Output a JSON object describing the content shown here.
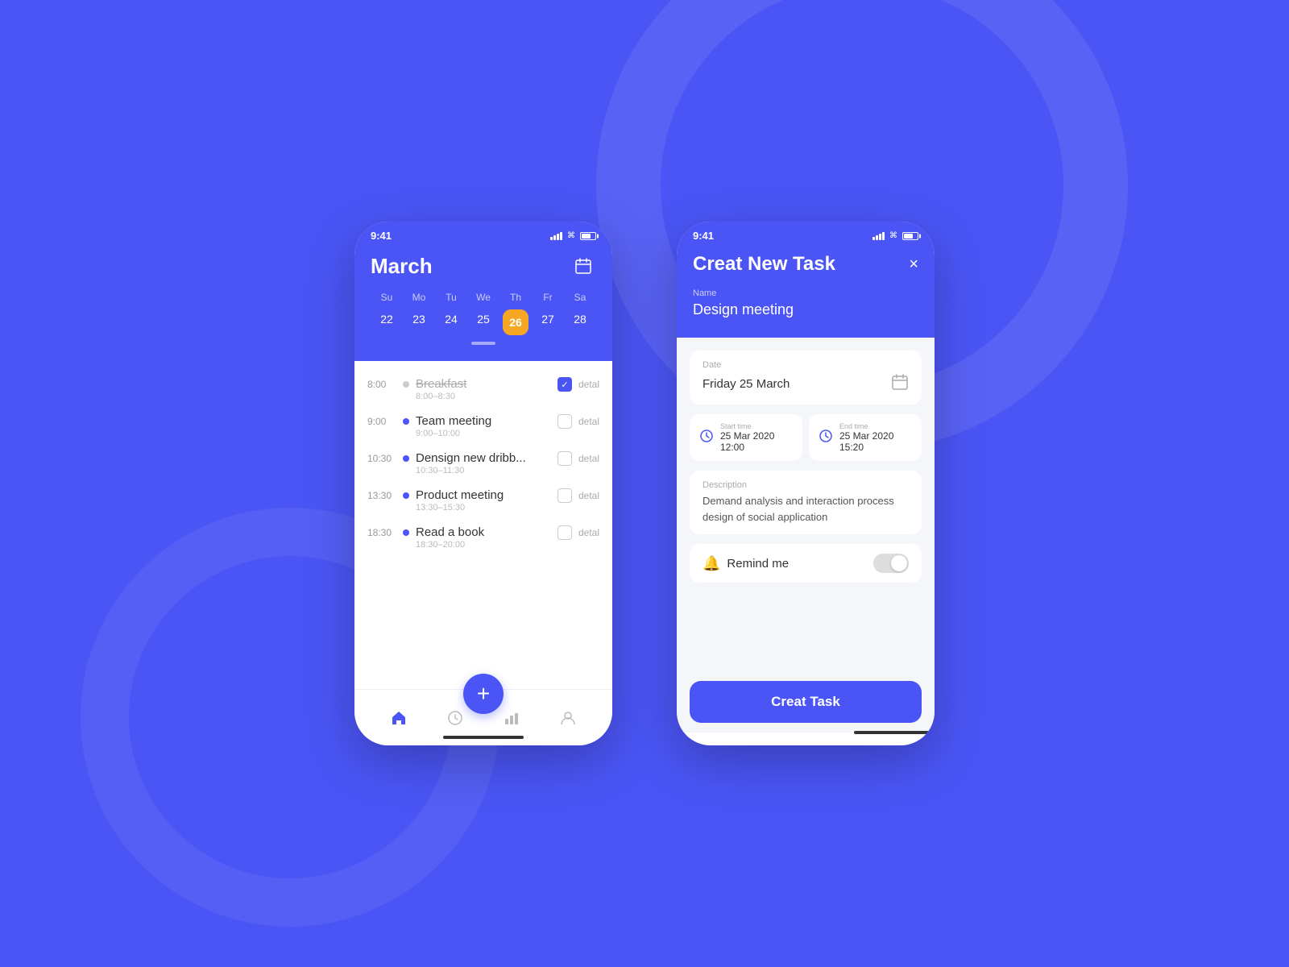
{
  "background_color": "#4B55F5",
  "phone1": {
    "status_time": "9:41",
    "calendar": {
      "month": "March",
      "day_labels": [
        "Su",
        "Mo",
        "Tu",
        "We",
        "Th",
        "Fr",
        "Sa"
      ],
      "dates": [
        "22",
        "23",
        "24",
        "25",
        "26",
        "27",
        "28"
      ],
      "active_date": "26",
      "active_day_index": 4
    },
    "tasks": [
      {
        "time": "8:00",
        "name": "Breakfast",
        "sub_time": "8:00–8:30",
        "done": true,
        "dot": "empty"
      },
      {
        "time": "9:00",
        "name": "Team meeting",
        "sub_time": "9:00–10:00",
        "done": false,
        "dot": "filled"
      },
      {
        "time": "10:30",
        "name": "Densign new dribb...",
        "sub_time": "10:30–11:30",
        "done": false,
        "dot": "filled"
      },
      {
        "time": "13:30",
        "name": "Product meeting",
        "sub_time": "13:30–15:30",
        "done": false,
        "dot": "filled"
      },
      {
        "time": "18:30",
        "name": "Read a book",
        "sub_time": "18:30–20:00",
        "done": false,
        "dot": "filled"
      }
    ],
    "detal_label": "detal",
    "nav_plus": "+",
    "home_bar": true
  },
  "phone2": {
    "status_time": "9:41",
    "header_title": "Creat New Task",
    "close_label": "×",
    "name_label": "Name",
    "name_value": "Design meeting",
    "date_label": "Date",
    "date_value": "Friday 25 March",
    "start_label": "Start time",
    "start_value": "25 Mar 2020  12:00",
    "end_label": "End time",
    "end_value": "25 Mar 2020  15:20",
    "description_label": "Description",
    "description_value": "Demand analysis and interaction process design of social application",
    "remind_label": "Remind me",
    "create_button": "Creat Task",
    "home_bar": true
  }
}
